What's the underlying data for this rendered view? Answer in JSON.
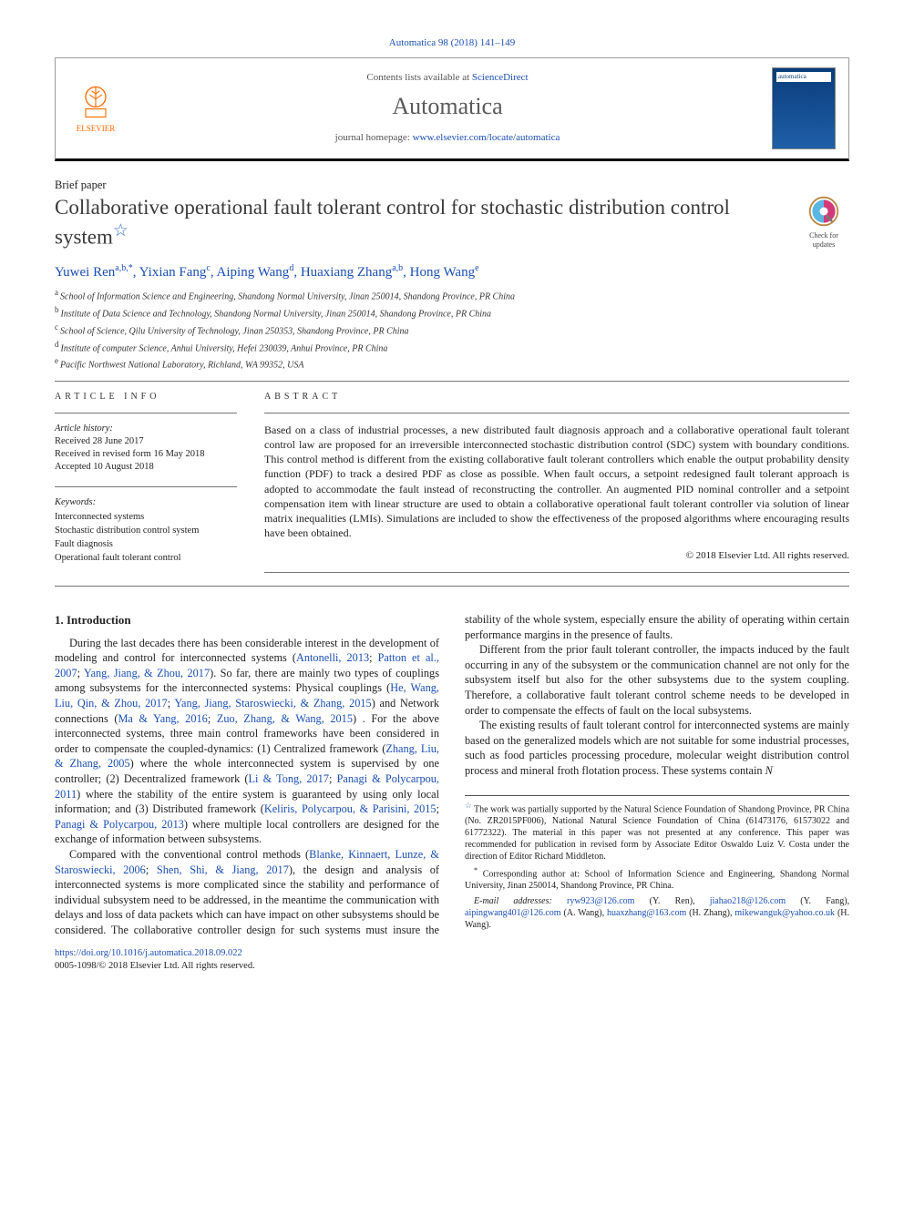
{
  "header": {
    "citation": "Automatica 98 (2018) 141–149",
    "contents_line_prefix": "Contents lists available at ",
    "contents_line_link": "ScienceDirect",
    "journal_name": "Automatica",
    "homepage_prefix": "journal homepage: ",
    "homepage_url": "www.elsevier.com/locate/automatica",
    "publisher_logo_label": "ELSEVIER",
    "cover_label": "automatica"
  },
  "paper": {
    "section_label": "Brief paper",
    "title": "Collaborative operational fault tolerant control for stochastic distribution control system",
    "title_star": "☆",
    "updates_badge": "Check for updates"
  },
  "authors": [
    {
      "name": "Yuwei Ren",
      "aff": "a,b,",
      "corr": "*"
    },
    {
      "name": "Yixian Fang",
      "aff": "c"
    },
    {
      "name": "Aiping Wang",
      "aff": "d"
    },
    {
      "name": "Huaxiang Zhang",
      "aff": "a,b"
    },
    {
      "name": "Hong Wang",
      "aff": "e"
    }
  ],
  "affiliations": [
    {
      "key": "a",
      "text": "School of Information Science and Engineering, Shandong Normal University, Jinan 250014, Shandong Province, PR China"
    },
    {
      "key": "b",
      "text": "Institute of Data Science and Technology, Shandong Normal University, Jinan 250014, Shandong Province, PR China"
    },
    {
      "key": "c",
      "text": "School of Science, Qilu University of Technology, Jinan 250353, Shandong Province, PR China"
    },
    {
      "key": "d",
      "text": "Institute of computer Science, Anhui University, Hefei 230039, Anhui Province, PR China"
    },
    {
      "key": "e",
      "text": "Pacific Northwest National Laboratory, Richland, WA 99352, USA"
    }
  ],
  "article_info": {
    "heading": "ARTICLE INFO",
    "history_label": "Article history:",
    "received": "Received 28 June 2017",
    "revised": "Received in revised form 16 May 2018",
    "accepted": "Accepted 10 August 2018",
    "keywords_label": "Keywords:",
    "keywords": [
      "Interconnected systems",
      "Stochastic distribution control system",
      "Fault diagnosis",
      "Operational fault tolerant control"
    ]
  },
  "abstract": {
    "heading": "ABSTRACT",
    "text": "Based on a class of industrial processes, a new distributed fault diagnosis approach and a collaborative operational fault tolerant control law are proposed for an irreversible interconnected stochastic distribution control (SDC) system with boundary conditions. This control method is different from the existing collaborative fault tolerant controllers which enable the output probability density function (PDF) to track a desired PDF as close as possible. When fault occurs, a setpoint redesigned fault tolerant approach is adopted to accommodate the fault instead of reconstructing the controller. An augmented PID nominal controller and a setpoint compensation item with linear structure are used to obtain a collaborative operational fault tolerant controller via solution of linear matrix inequalities (LMIs). Simulations are included to show the effectiveness of the proposed algorithms where encouraging results have been obtained.",
    "copyright": "© 2018 Elsevier Ltd. All rights reserved."
  },
  "body": {
    "section1_heading": "1. Introduction",
    "p1a": "During the last decades there has been considerable interest in the development of modeling and control for interconnected systems (",
    "p1_ref1": "Antonelli, 2013",
    "p1b": "; ",
    "p1_ref2": "Patton et al., 2007",
    "p1c": "; ",
    "p1_ref3": "Yang, Jiang, & Zhou, 2017",
    "p1d": "). So far, there are mainly two types of couplings among subsystems for the interconnected systems: Physical couplings (",
    "p1_ref4": "He, Wang, Liu, Qin, & Zhou, 2017",
    "p1e": "; ",
    "p1_ref5": "Yang, Jiang, Staroswiecki, & Zhang, 2015",
    "p1f": ") and Network connections (",
    "p1_ref6": "Ma & Yang, 2016",
    "p1g": "; ",
    "p1_ref7": "Zuo, Zhang, & Wang, 2015",
    "p1h": ") . For the above interconnected systems, three main control frameworks have been considered in order to compensate the coupled-dynamics: (1) Centralized framework (",
    "p1_ref8": "Zhang, Liu, & Zhang, 2005",
    "p1i": ") where the whole interconnected system is supervised by one controller; (2) Decentralized framework (",
    "p1_ref9": "Li & Tong, 2017",
    "p1j": "; ",
    "p1_ref10": "Panagi & Polycarpou, 2011",
    "p1k": ") where the stability of the ",
    "p1l": "entire system is guaranteed by using only local information; and (3) Distributed framework (",
    "p1_ref11": "Keliris, Polycarpou, & Parisini, 2015",
    "p1m": "; ",
    "p1_ref12": "Panagi & Polycarpou, 2013",
    "p1n": ") where multiple local controllers are designed for the exchange of information between subsystems.",
    "p2a": "Compared with the conventional control methods (",
    "p2_ref1": "Blanke, Kinnaert, Lunze, & Staroswiecki, 2006",
    "p2b": "; ",
    "p2_ref2": "Shen, Shi, & Jiang, 2017",
    "p2c": "), the design and analysis of interconnected systems is more complicated since the stability and performance of individual subsystem need to be addressed, in the meantime the communication with delays and loss of data packets which can have impact on other subsystems should be considered. The collaborative controller design for such systems must insure the stability of the whole system, especially ensure the ability of operating within certain performance margins in the presence of faults.",
    "p3": "Different from the prior fault tolerant controller, the impacts induced by the fault occurring in any of the subsystem or the communication channel are not only for the subsystem itself but also for the other subsystems due to the system coupling. Therefore, a collaborative fault tolerant control scheme needs to be developed in order to compensate the effects of fault on the local subsystems.",
    "p4a": "The existing results of fault tolerant control for interconnected systems are mainly based on the generalized models which are not suitable for some industrial processes, such as food particles processing procedure, molecular weight distribution control process and mineral froth flotation process. These systems contain ",
    "p4b": "N"
  },
  "footnotes": {
    "funding_star": "☆",
    "funding": " The work was partially supported by the Natural Science Foundation of Shandong Province, PR China (No. ZR2015PF006), National Natural Science Foundation of China (61473176, 61573022 and 61772322). The material in this paper was not presented at any conference. This paper was recommended for publication in revised form by Associate Editor Oswaldo Luiz V. Costa under the direction of Editor Richard Middleton.",
    "corr_star": "*",
    "corr": " Corresponding author at: School of Information Science and Engineering, Shandong Normal University, Jinan 250014, Shandong Province, PR China.",
    "email_label": "E-mail addresses: ",
    "emails": [
      {
        "addr": "ryw923@126.com",
        "who": "(Y. Ren)"
      },
      {
        "addr": "jiahao218@126.com",
        "who": "(Y. Fang)"
      },
      {
        "addr": "aipingwang401@126.com",
        "who": "(A. Wang)"
      },
      {
        "addr": "huaxzhang@163.com",
        "who": "(H. Zhang)"
      },
      {
        "addr": "mikewanguk@yahoo.co.uk",
        "who": "(H. Wang)"
      }
    ]
  },
  "doi": {
    "url": "https://doi.org/10.1016/j.automatica.2018.09.022",
    "issn_line": "0005-1098/© 2018 Elsevier Ltd. All rights reserved."
  }
}
